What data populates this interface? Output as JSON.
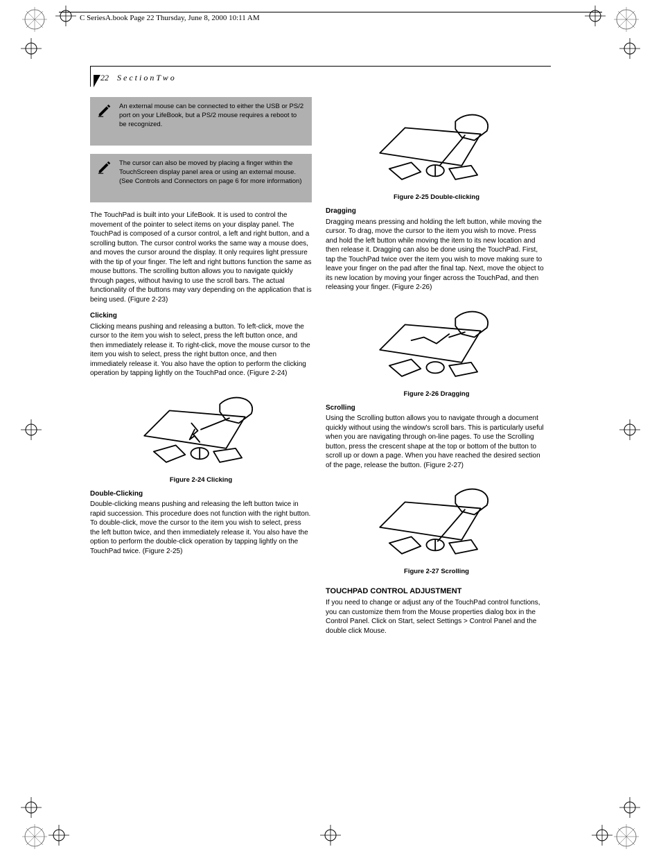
{
  "header": {
    "running": "C SeriesA.book  Page 22  Thursday, June 8, 2000  10:11 AM"
  },
  "page": {
    "number": "22",
    "section_label": "S e c t i o n   T w o"
  },
  "col1": {
    "note1": "An external mouse can be connected to either the USB or PS/2 port on your LifeBook, but a PS/2 mouse requires a reboot to be recognized.",
    "note2": "The cursor can also be moved by placing a finger within the TouchScreen display panel area or using an external mouse. (See Controls and Connectors on page 6 for more information)",
    "p1": "The TouchPad is built into your LifeBook. It is used to control the movement of the pointer to select items on your display panel. The TouchPad is composed of a cursor control, a left and right button, and a scrolling button. The cursor control works the same way a mouse does, and moves the cursor around the display. It only requires light pressure with the tip of your finger. The left and right buttons function the same as mouse buttons. The scrolling button allows you to navigate quickly through pages, without having to use the scroll bars. The actual functionality of the buttons may vary depending on the application that is being used. (Figure 2-23)",
    "clicking_head": "Clicking",
    "clicking_text": "Clicking means pushing and releasing a button. To left-click, move the cursor to the item you wish to select, press the left button once, and then immediately release it. To right-click, move the mouse cursor to the item you wish to select, press the right button once, and then immediately release it. You also have the option to perform the clicking operation by tapping lightly on the TouchPad once. (Figure 2-24)",
    "fig24_caption": "Figure 2-24 Clicking",
    "dblclick_head": "Double-Clicking",
    "dblclick_text": "Double-clicking means pushing and releasing the left button twice in rapid succession. This procedure does not function with the right button. To double-click, move the cursor to the item you wish to select, press the left button twice, and then immediately release it. You also have the option to perform the double-click operation by tapping lightly on the TouchPad twice. (Figure 2-25)"
  },
  "col2": {
    "fig25_caption": "Figure 2-25 Double-clicking",
    "dragging_head": "Dragging",
    "dragging_text": "Dragging means pressing and holding the left button, while moving the cursor. To drag, move the cursor to the item you wish to move. Press and hold the left button while moving the item to its new location and then release it. Dragging can also be done using the TouchPad. First, tap the TouchPad twice over the item you wish to move making sure to leave your finger on the pad after the final tap. Next, move the object to its new location by moving your finger across the TouchPad, and then releasing your finger. (Figure 2-26)",
    "fig26_caption": "Figure 2-26 Dragging",
    "scrolling_head": "Scrolling",
    "scrolling_text": "Using the Scrolling button allows you to navigate through a document quickly without using the window's scroll bars. This is particularly useful when you are navigating through on-line pages. To use the Scrolling button, press the crescent shape at the top or bottom of the button to scroll up or down a page. When you have reached the desired section of the page, release the button. (Figure 2-27)",
    "fig27_caption": "Figure 2-27 Scrolling",
    "tpc_head": "TOUCHPAD CONTROL ADJUSTMENT",
    "tpc_text": "If you need to change or adjust any of the TouchPad control functions, you can customize them from the Mouse properties dialog box in the Control Panel. Click on Start, select Settings > Control Panel and the double click Mouse."
  }
}
